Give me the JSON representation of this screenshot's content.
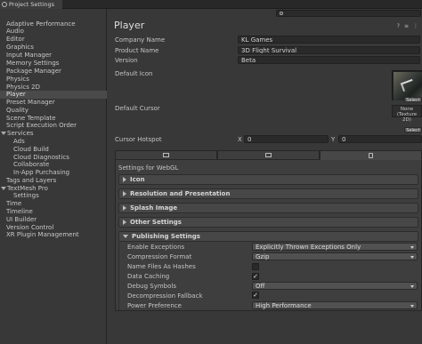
{
  "window": {
    "tab_title": "Project Settings"
  },
  "sidebar": {
    "items": [
      {
        "label": "Adaptive Performance"
      },
      {
        "label": "Audio"
      },
      {
        "label": "Editor"
      },
      {
        "label": "Graphics"
      },
      {
        "label": "Input Manager"
      },
      {
        "label": "Memory Settings"
      },
      {
        "label": "Package Manager"
      },
      {
        "label": "Physics"
      },
      {
        "label": "Physics 2D"
      },
      {
        "label": "Player"
      },
      {
        "label": "Preset Manager"
      },
      {
        "label": "Quality"
      },
      {
        "label": "Scene Template"
      },
      {
        "label": "Script Execution Order"
      },
      {
        "label": "Services"
      },
      {
        "label": "Ads"
      },
      {
        "label": "Cloud Build"
      },
      {
        "label": "Cloud Diagnostics"
      },
      {
        "label": "Collaborate"
      },
      {
        "label": "In-App Purchasing"
      },
      {
        "label": "Tags and Layers"
      },
      {
        "label": "TextMesh Pro"
      },
      {
        "label": "Settings"
      },
      {
        "label": "Time"
      },
      {
        "label": "Timeline"
      },
      {
        "label": "UI Builder"
      },
      {
        "label": "Version Control"
      },
      {
        "label": "XR Plugin Management"
      }
    ]
  },
  "main": {
    "title": "Player",
    "company_label": "Company Name",
    "company_value": "KL Games",
    "product_label": "Product Name",
    "product_value": "3D Flight Survival",
    "version_label": "Version",
    "version_value": "Beta",
    "default_icon_label": "Default Icon",
    "default_cursor_label": "Default Cursor",
    "icon_select_label": "Select",
    "cursor_none_label": "None (Texture 2D)",
    "cursor_select_label": "Select",
    "hotspot_label": "Cursor Hotspot",
    "hotspot_x_label": "X",
    "hotspot_x_value": "0",
    "hotspot_y_label": "Y",
    "hotspot_y_value": "0",
    "settings_for": "Settings for WebGL"
  },
  "sections": {
    "icon": "Icon",
    "resolution": "Resolution and Presentation",
    "splash": "Splash Image",
    "other": "Other Settings",
    "publishing": "Publishing Settings"
  },
  "publishing": {
    "enable_exceptions_label": "Enable Exceptions",
    "enable_exceptions_value": "Explicitly Thrown Exceptions Only",
    "compression_label": "Compression Format",
    "compression_value": "Gzip",
    "name_files_label": "Name Files As Hashes",
    "data_caching_label": "Data Caching",
    "debug_symbols_label": "Debug Symbols",
    "debug_symbols_value": "Off",
    "decompression_label": "Decompression Fallback",
    "power_label": "Power Preference",
    "power_value": "High Performance",
    "checkmark": "✓"
  },
  "colors": {
    "background": "#383838",
    "selected_item": "#4a4a4a",
    "field_bg": "#2a2a2a"
  }
}
